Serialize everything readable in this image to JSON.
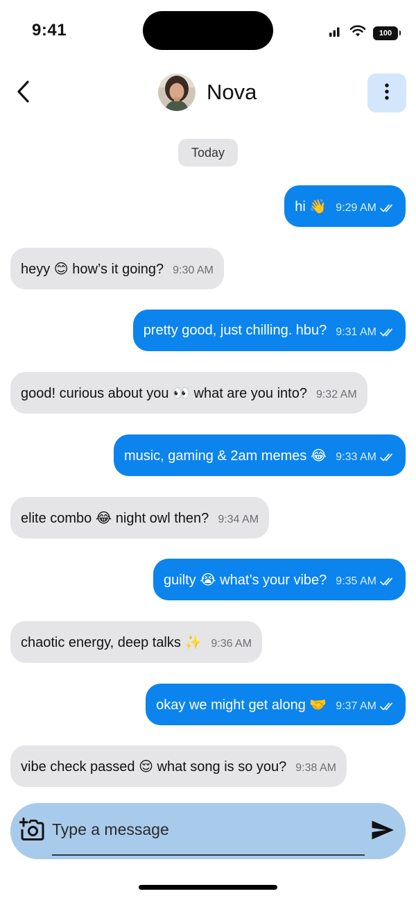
{
  "status_bar": {
    "time": "9:41",
    "battery": "100"
  },
  "header": {
    "contact_name": "Nova"
  },
  "date_chip": "Today",
  "messages": [
    {
      "direction": "out",
      "text": "hi 👋",
      "time": "9:29 AM",
      "read": true
    },
    {
      "direction": "in",
      "text": "heyy 😊 how’s it going?",
      "time": "9:30 AM"
    },
    {
      "direction": "out",
      "text": "pretty good, just chilling. hbu?",
      "time": "9:31 AM",
      "read": true
    },
    {
      "direction": "in",
      "text": "good! curious about you 👀 what are you into?",
      "time": "9:32 AM"
    },
    {
      "direction": "out",
      "text": "music, gaming & 2am memes 😂",
      "time": "9:33 AM",
      "read": true
    },
    {
      "direction": "in",
      "text": "elite combo 😂 night owl then?",
      "time": "9:34 AM"
    },
    {
      "direction": "out",
      "text": "guilty 😭 what’s your vibe?",
      "time": "9:35 AM",
      "read": true
    },
    {
      "direction": "in",
      "text": "chaotic energy, deep talks ✨",
      "time": "9:36 AM"
    },
    {
      "direction": "out",
      "text": "okay we might get along 🤝",
      "time": "9:37 AM",
      "read": true
    },
    {
      "direction": "in",
      "text": "vibe check passed 😌 what song is so you?",
      "time": "9:38 AM"
    }
  ],
  "composer": {
    "placeholder": "Type a message",
    "value": ""
  },
  "icons": {
    "back": "chevron-left-icon",
    "menu": "more-vertical-icon",
    "camera": "add-photo-icon",
    "send": "send-icon",
    "read_receipt": "double-check-icon"
  },
  "colors": {
    "outgoing_bubble": "#0b84ee",
    "incoming_bubble": "#e5e5e7",
    "composer_bg": "#a9cbeb",
    "menu_button_bg": "#d3e6fb"
  }
}
